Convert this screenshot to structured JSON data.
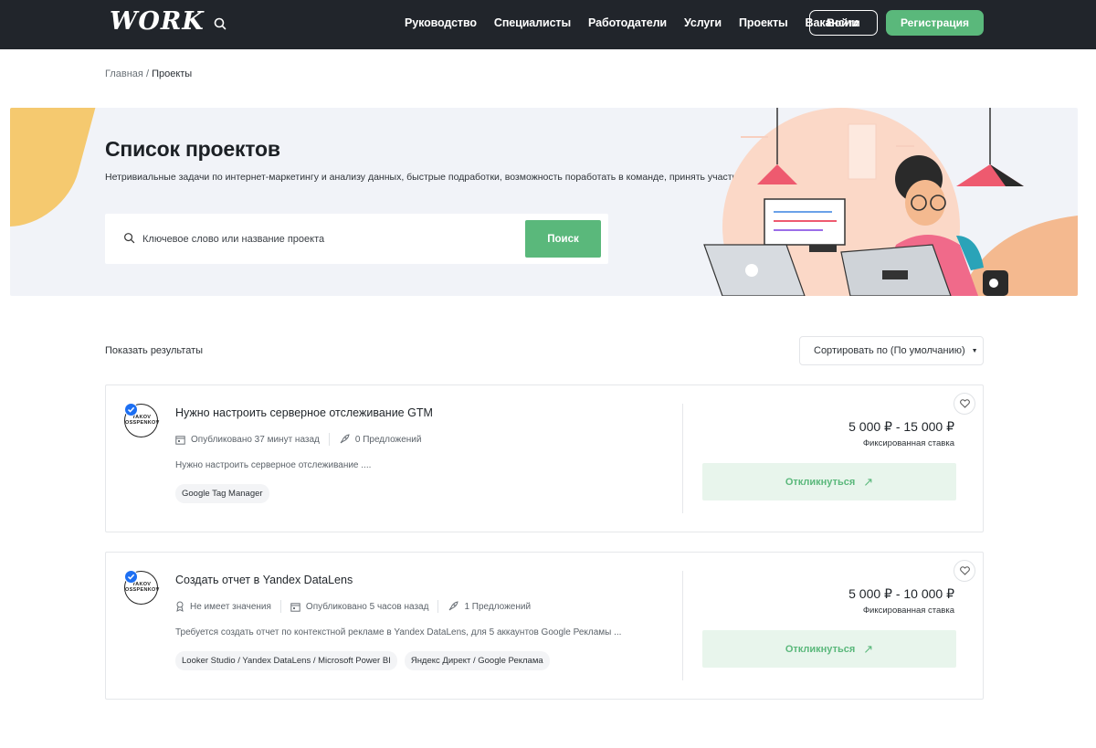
{
  "header": {
    "logo": "WORK",
    "nav": [
      "Руководство",
      "Специалисты",
      "Работодатели",
      "Услуги",
      "Проекты",
      "Вакансии"
    ],
    "login_label": "Войти",
    "register_label": "Регистрация"
  },
  "breadcrumb": {
    "home": "Главная",
    "separator": "/",
    "current": "Проекты"
  },
  "hero": {
    "title": "Список проектов",
    "subtitle": "Нетривиальные задачи по интернет-маркетингу и анализу данных, быстрые подработки, возможность поработать в команде, принять участие в интересном проекте и многое другое",
    "search_placeholder": "Ключевое слово или название проекта",
    "search_button": "Поиск"
  },
  "results": {
    "show_label": "Показать результаты",
    "sort_label": "Сортировать по (По умолчанию)"
  },
  "projects": [
    {
      "avatar_text": "YAKOV OSSPENKOV",
      "title": "Нужно настроить серверное отслеживание GTM",
      "meta": [
        "Опубликовано 37 минут назад",
        "0 Предложений"
      ],
      "description": "Нужно настроить серверное отслеживание ....",
      "tags": [
        "Google Tag Manager"
      ],
      "price": "5 000 ₽ - 15 000 ₽",
      "price_type": "Фиксированная ставка",
      "respond_label": "Откликнуться"
    },
    {
      "avatar_text": "YAKOV OSSPENKOV",
      "title": "Создать отчет в Yandex DataLens",
      "meta": [
        "Не имеет значения",
        "Опубликовано 5 часов назад",
        "1 Предложений"
      ],
      "description": "Требуется создать отчет по контекстной рекламе в Yandex DataLens, для 5 аккаунтов Google Рекламы ...",
      "tags": [
        "Looker Studio / Yandex DataLens / Microsoft Power BI",
        "Яндекс Директ / Google Реклама"
      ],
      "price": "5 000 ₽ - 10 000 ₽",
      "price_type": "Фиксированная ставка",
      "respond_label": "Откликнуться"
    }
  ],
  "colors": {
    "header_bg": "#21252b",
    "accent_green": "#5ab87b",
    "hero_bg": "#f1f3f8"
  }
}
